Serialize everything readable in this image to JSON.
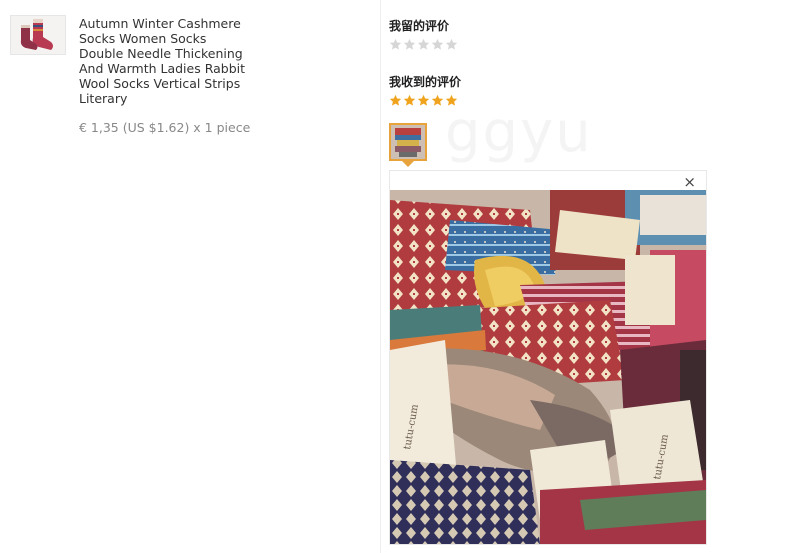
{
  "product": {
    "title": "Autumn Winter Cashmere Socks Women Socks Double Needle Thickening And Warmth Ladies Rabbit Wool Socks Vertical Strips Literary",
    "price_line": "€ 1,35 (US $1.62) x 1 piece",
    "thumbnail_icon": "socks-thumbnail"
  },
  "reviews": {
    "my_review_title": "我留的评价",
    "my_review_rating": 0,
    "received_review_title": "我收到的评价",
    "received_review_rating": 5,
    "max_rating": 5,
    "star_filled_color": "#f0a31c",
    "star_empty_color": "#d6d6d6",
    "accent_color": "#e8a33c"
  },
  "viewer": {
    "close_label": "×"
  },
  "watermark": "ggyu"
}
